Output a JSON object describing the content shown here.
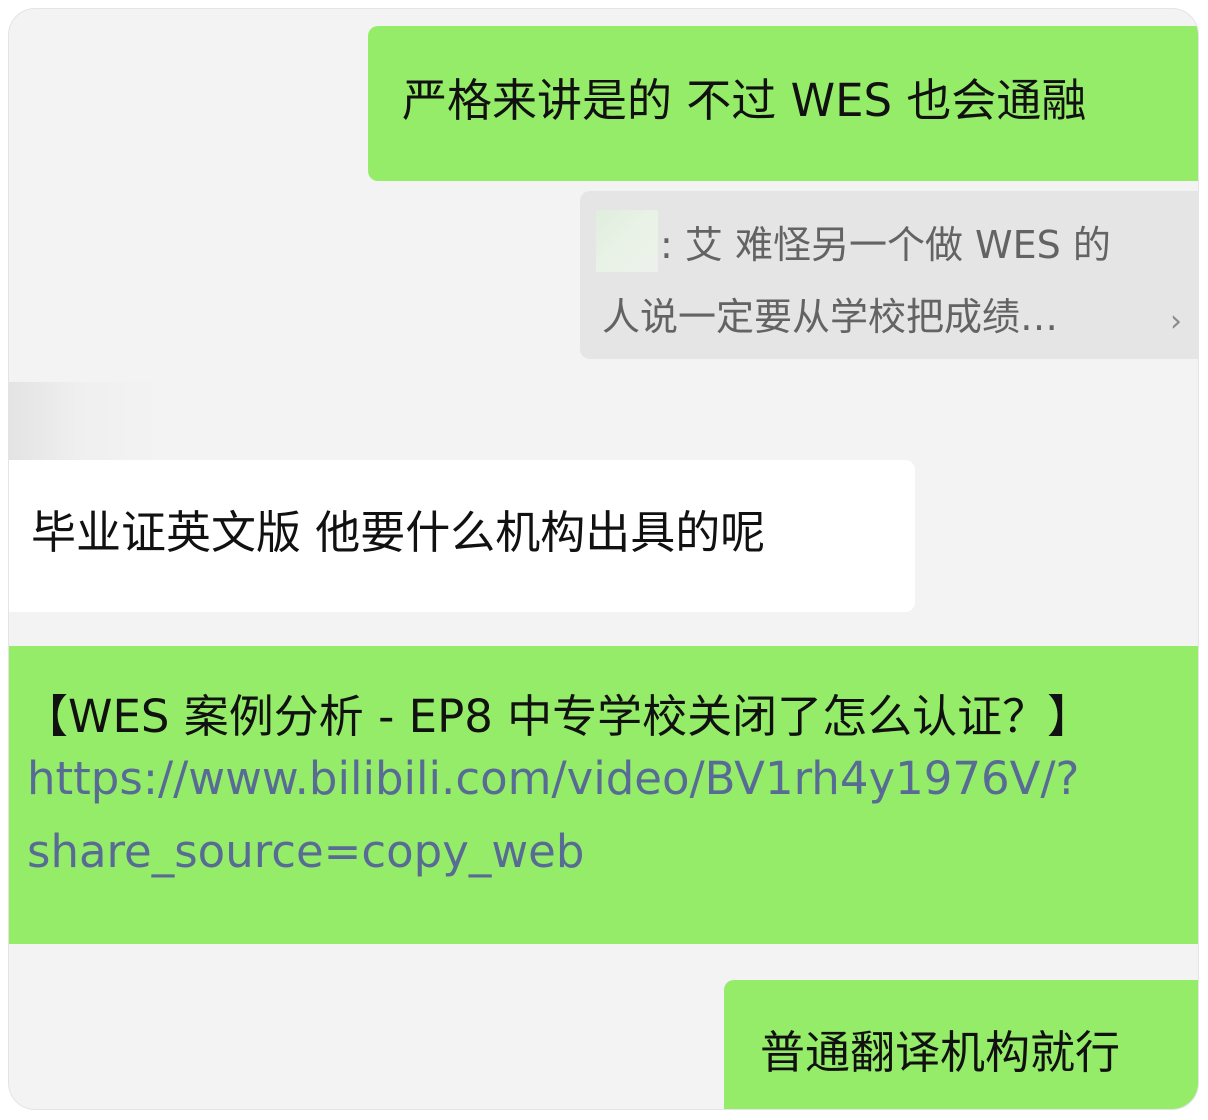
{
  "chat": {
    "messages": [
      {
        "direction": "outgoing",
        "text": "严格来讲是的 不过 WES 也会通融"
      },
      {
        "direction": "incoming",
        "text": "毕业证英文版 他要什么机构出具的呢"
      },
      {
        "direction": "outgoing",
        "title": "【WES 案例分析 - EP8 中专学校关闭了怎么认证？】",
        "link_lines": [
          "https://www.bilibili.com/video/BV1rh4y1976V/?",
          "share_source=copy_web"
        ]
      },
      {
        "direction": "outgoing",
        "text": "普通翻译机构就行"
      }
    ],
    "quote": {
      "line1": ": 艾 难怪另一个做 WES 的",
      "line2": "人说一定要从学校把成绩…",
      "chevron": "›"
    }
  },
  "colors": {
    "outgoing_bubble": "#95ec69",
    "incoming_bubble": "#ffffff",
    "quote_bg": "#e5e5e5",
    "link": "#576b95",
    "chat_bg": "#f3f3f3"
  }
}
